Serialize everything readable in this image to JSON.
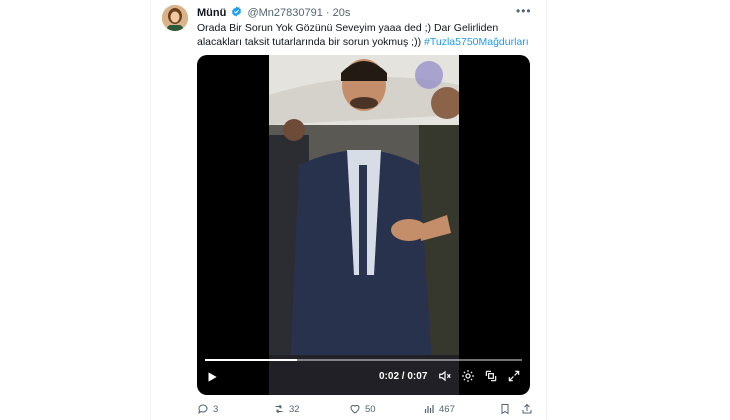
{
  "tweet": {
    "display_name": "Münü",
    "handle": "@Mn27830791",
    "separator": "·",
    "time": "20s",
    "more_label": "•••",
    "text": "Orada Bir Sorun Yok Gözünü Seveyim yaaa ded ;) Dar Gelirliden alacakları taksit tutarlarında bir sorun yokmuş ;)) ",
    "hashtag": "#Tuzla5750Mağdurları"
  },
  "video": {
    "current_time": "0:02",
    "time_separator": "/",
    "duration": "0:07",
    "progress_fraction": 0.29,
    "icons": [
      "play-icon",
      "volume-icon",
      "settings-icon",
      "pip-icon",
      "fullscreen-icon"
    ]
  },
  "actions": {
    "replies": "3",
    "reposts": "32",
    "likes": "50",
    "views": "467"
  },
  "colors": {
    "accent": "#1d9bf0",
    "text": "#0f1419",
    "muted": "#536471"
  }
}
